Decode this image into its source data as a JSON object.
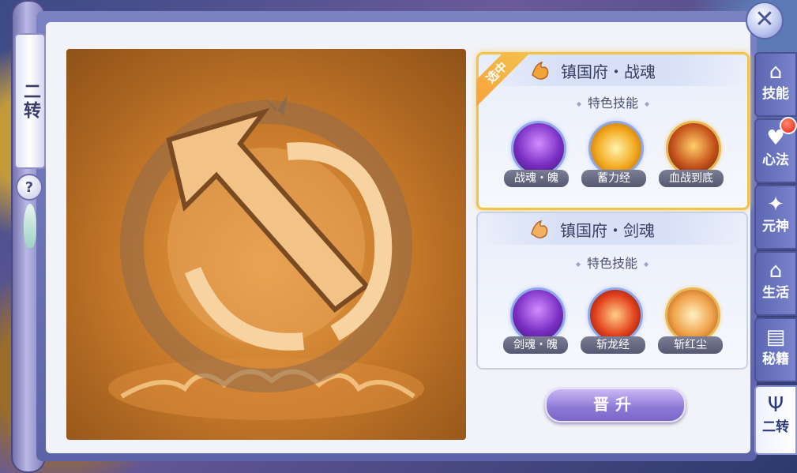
{
  "rank_tag": "二转",
  "help_icon": "?",
  "close_icon": "✕",
  "tabs": [
    {
      "label": "技能",
      "icon": "⌂",
      "badge": false,
      "active": false
    },
    {
      "label": "心法",
      "icon": "♥",
      "badge": true,
      "active": false
    },
    {
      "label": "元神",
      "icon": "✦",
      "badge": false,
      "active": false
    },
    {
      "label": "生活",
      "icon": "⌂",
      "badge": false,
      "active": false
    },
    {
      "label": "秘籍",
      "icon": "▤",
      "badge": false,
      "active": false
    },
    {
      "label": "二转",
      "icon": "Ψ",
      "badge": false,
      "active": true
    }
  ],
  "paths": [
    {
      "title": "镇国府・战魂",
      "selected_label": "选中",
      "subheading": "特色技能",
      "skills": [
        {
          "name": "战魂・魄",
          "style": "purple"
        },
        {
          "name": "蓄力经",
          "style": "yellow"
        },
        {
          "name": "血战到底",
          "style": "fire"
        }
      ]
    },
    {
      "title": "镇国府・剑魂",
      "subheading": "特色技能",
      "skills": [
        {
          "name": "剑魂・魄",
          "style": "purple"
        },
        {
          "name": "斩龙经",
          "style": "red"
        },
        {
          "name": "斩红尘",
          "style": "amber"
        }
      ]
    }
  ],
  "promote_button": "晋升",
  "colors": {
    "selected_border": "#f2c24a",
    "ribbon": "#f7a23c",
    "promote": "#8c78d6",
    "panel_frame": "#6a72b8"
  }
}
